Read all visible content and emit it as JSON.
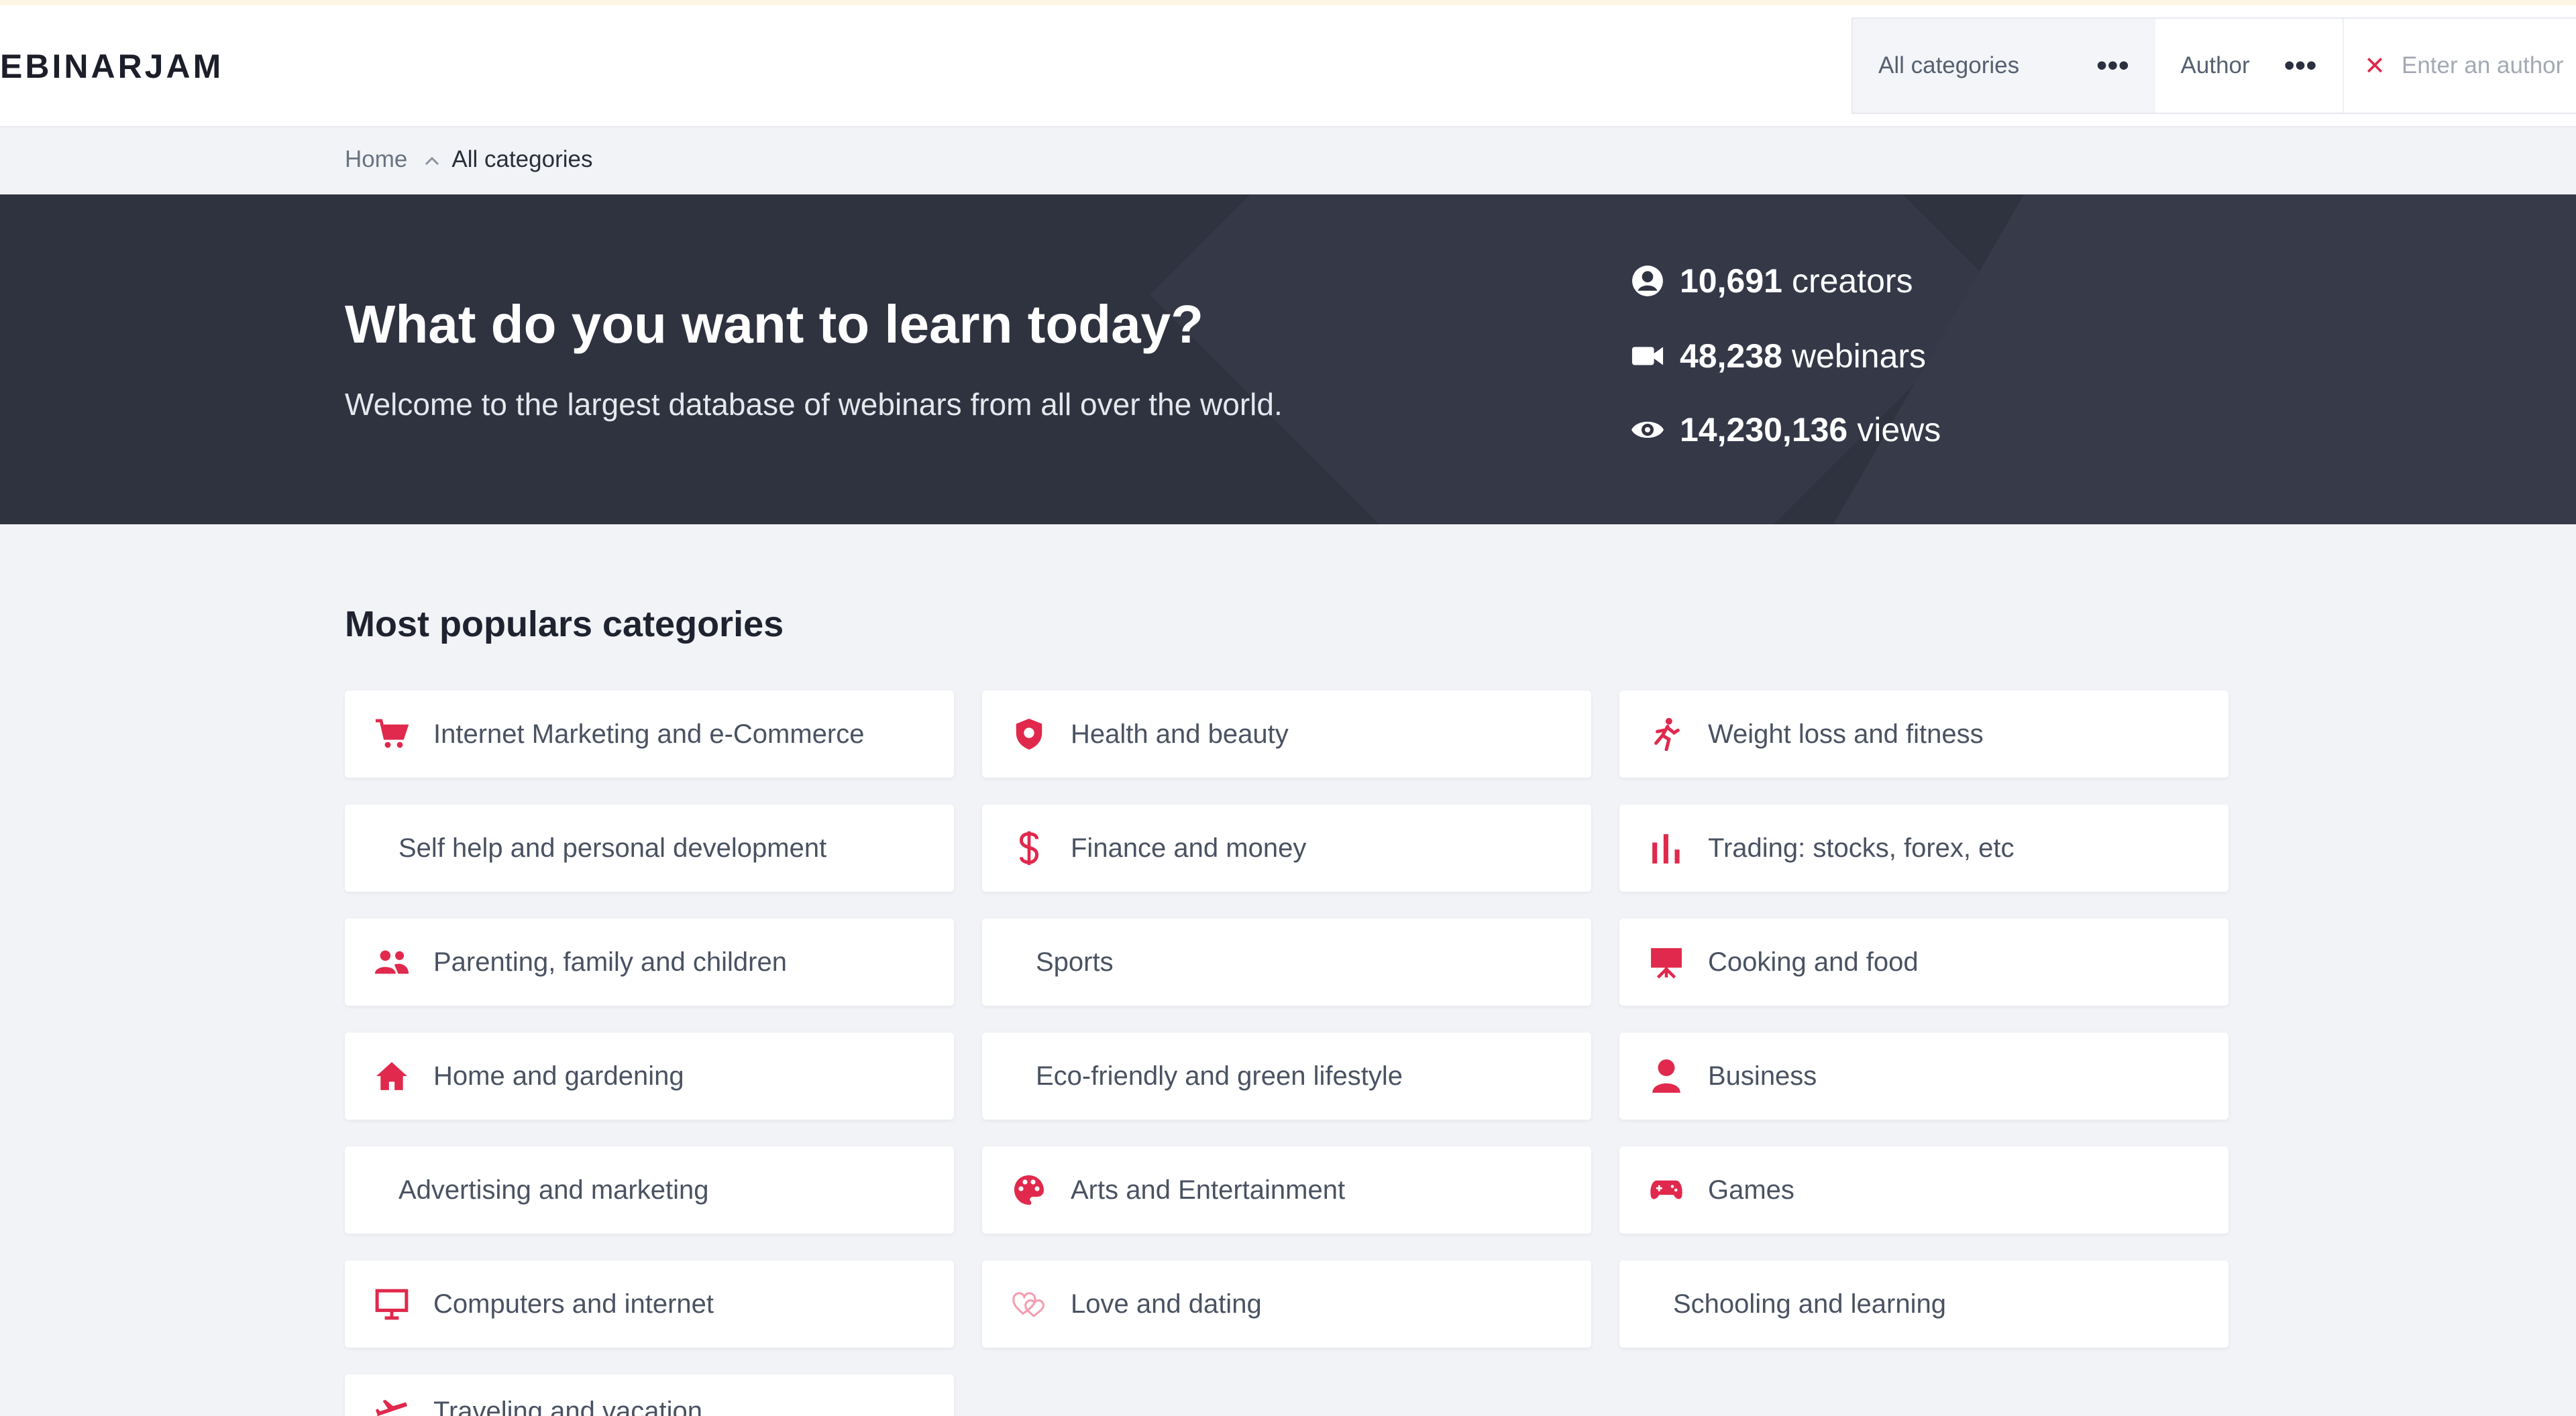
{
  "header": {
    "logo": "EBINARJAM",
    "filters": {
      "category": "All categories",
      "author": "Author",
      "author_placeholder": "Enter an author"
    }
  },
  "breadcrumb": {
    "home": "Home",
    "current": "All categories"
  },
  "hero": {
    "title": "What do you want to learn today?",
    "subtitle": "Welcome to the largest database of webinars from all over the world.",
    "stats": [
      {
        "count": "10,691",
        "label": "creators",
        "icon": "user-circle-icon"
      },
      {
        "count": "48,238",
        "label": "webinars",
        "icon": "video-camera-icon"
      },
      {
        "count": "14,230,136",
        "label": "views",
        "icon": "eye-icon"
      }
    ]
  },
  "section": {
    "title": "Most populars categories"
  },
  "categories": [
    {
      "label": "Internet Marketing and e-Commerce",
      "icon": "cart-icon"
    },
    {
      "label": "Health and beauty",
      "icon": "shield-icon"
    },
    {
      "label": "Weight loss and fitness",
      "icon": "running-icon"
    },
    {
      "label": "Self help and personal development",
      "icon": ""
    },
    {
      "label": "Finance and money",
      "icon": "dollar-icon"
    },
    {
      "label": "Trading: stocks, forex, etc",
      "icon": "bar-chart-icon"
    },
    {
      "label": "Parenting, family and children",
      "icon": "people-icon"
    },
    {
      "label": "Sports",
      "icon": ""
    },
    {
      "label": "Cooking and food",
      "icon": "easel-icon"
    },
    {
      "label": "Home and gardening",
      "icon": "house-icon"
    },
    {
      "label": "Eco-friendly and green lifestyle",
      "icon": ""
    },
    {
      "label": "Business",
      "icon": "person-icon"
    },
    {
      "label": "Advertising and marketing",
      "icon": ""
    },
    {
      "label": "Arts and Entertainment",
      "icon": "palette-icon"
    },
    {
      "label": "Games",
      "icon": "gamepad-icon"
    },
    {
      "label": "Computers and internet",
      "icon": "monitor-icon"
    },
    {
      "label": "Love and dating",
      "icon": "hearts-icon"
    },
    {
      "label": "Schooling and learning",
      "icon": ""
    },
    {
      "label": "Traveling and vacation",
      "icon": "plane-icon"
    }
  ],
  "colors": {
    "accent": "#e0294c",
    "hero_bg": "#2f3340",
    "page_bg": "#f1f3f6"
  }
}
